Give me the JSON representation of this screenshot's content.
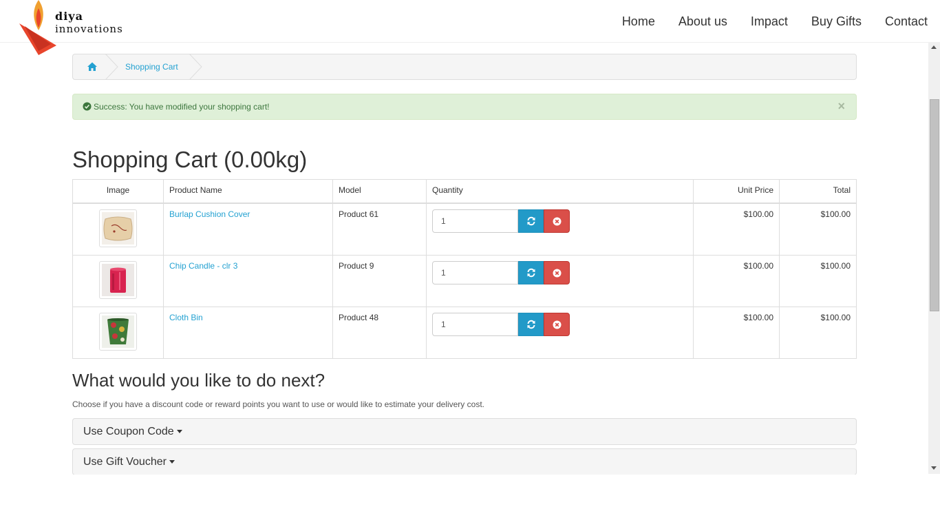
{
  "brand": {
    "line1": "diya",
    "line2": "innovations"
  },
  "nav": [
    {
      "label": "Home"
    },
    {
      "label": "About us"
    },
    {
      "label": "Impact"
    },
    {
      "label": "Buy Gifts"
    },
    {
      "label": "Contact"
    }
  ],
  "breadcrumb": {
    "current": "Shopping Cart"
  },
  "alert": {
    "text": "Success: You have modified your shopping cart!",
    "close": "×"
  },
  "page_title": "Shopping Cart  (0.00kg)",
  "table": {
    "headers": {
      "image": "Image",
      "name": "Product Name",
      "model": "Model",
      "quantity": "Quantity",
      "unit_price": "Unit Price",
      "total": "Total"
    },
    "rows": [
      {
        "name": "Burlap Cushion Cover",
        "model": "Product 61",
        "quantity": "1",
        "unit_price": "$100.00",
        "total": "$100.00"
      },
      {
        "name": "Chip Candle - clr 3",
        "model": "Product 9",
        "quantity": "1",
        "unit_price": "$100.00",
        "total": "$100.00"
      },
      {
        "name": "Cloth Bin",
        "model": "Product 48",
        "quantity": "1",
        "unit_price": "$100.00",
        "total": "$100.00"
      }
    ]
  },
  "next": {
    "title": "What would you like to do next?",
    "hint": "Choose if you have a discount code or reward points you want to use or would like to estimate your delivery cost.",
    "panels": [
      {
        "title": "Use Coupon Code"
      },
      {
        "title": "Use Gift Voucher"
      }
    ]
  },
  "colors": {
    "link": "#23a1d1",
    "update_button": "#229ac8",
    "remove_button": "#da4f49",
    "alert_bg": "#dff0d8",
    "alert_text": "#3c763d"
  }
}
